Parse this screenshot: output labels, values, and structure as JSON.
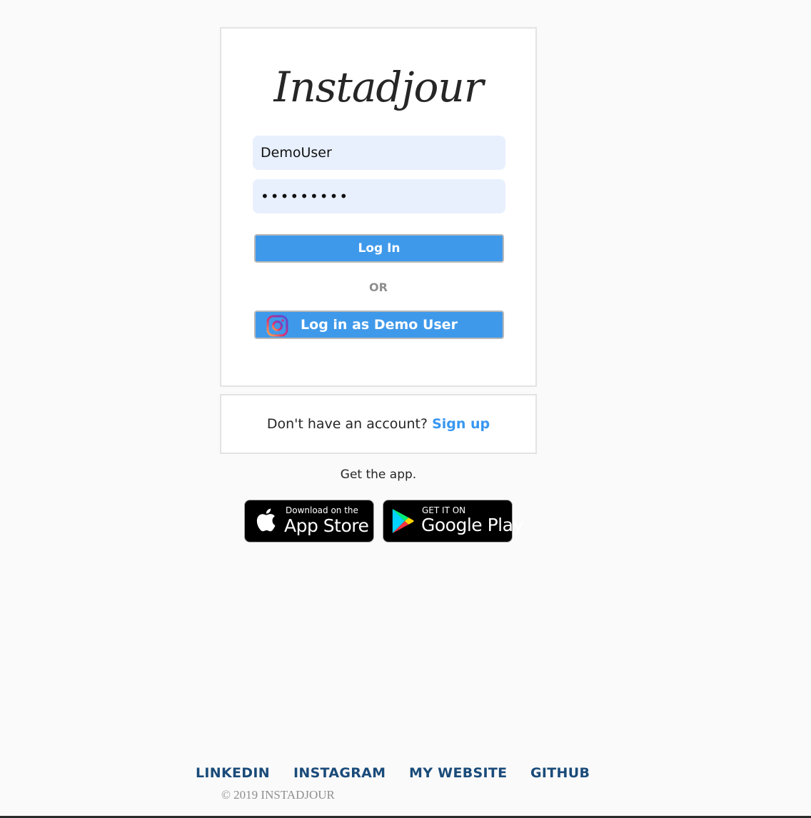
{
  "login": {
    "brand": "Instadjour",
    "username_value": "DemoUser",
    "password_value": "•••••••••",
    "login_button": "Log In",
    "or_text": "OR",
    "demo_button": "Log in as Demo User"
  },
  "signup": {
    "prompt": "Don't have an account?",
    "link": "Sign up"
  },
  "get_app": {
    "text": "Get the app.",
    "app_store_small": "Download on the",
    "app_store_big": "App Store",
    "google_play_small": "GET IT ON",
    "google_play_big": "Google Play"
  },
  "footer": {
    "links": [
      "LINKEDIN",
      "INSTAGRAM",
      "MY WEBSITE",
      "GITHUB"
    ],
    "copyright": "© 2019 INSTADJOUR"
  },
  "colors": {
    "accent": "#3f99ea",
    "link": "#3897f0",
    "footer_link": "#1a4b7a"
  }
}
